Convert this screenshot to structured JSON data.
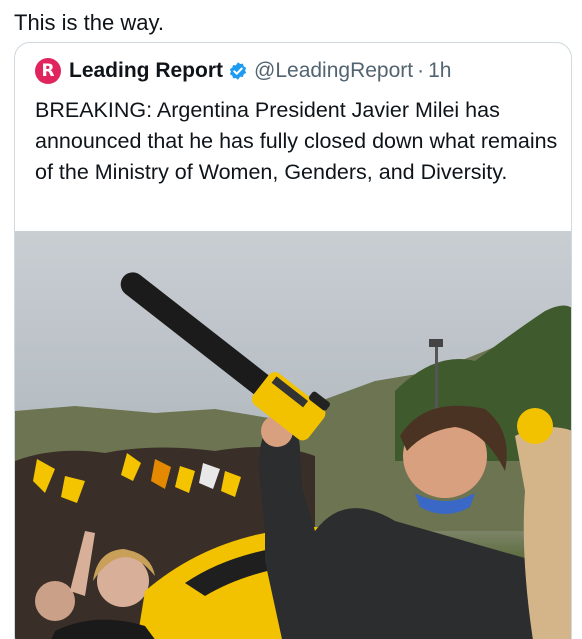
{
  "post": {
    "text": "This is the way."
  },
  "quote": {
    "avatar_letter": "R",
    "author_name": "Leading Report",
    "verified_icon": "verified-badge-icon",
    "handle": "@LeadingReport",
    "separator": "·",
    "time": "1h",
    "body": "BREAKING: Argentina President Javier Milei has announced that he has fully closed down what remains of the Ministry of Women, Genders, and Diversity.",
    "media": {
      "description_icon": "photo-image"
    }
  },
  "colors": {
    "avatar_bg": "#e0245e",
    "verified_blue": "#1d9bf0",
    "handle_gray": "#536471",
    "chainsaw_yellow": "#f2c200"
  }
}
